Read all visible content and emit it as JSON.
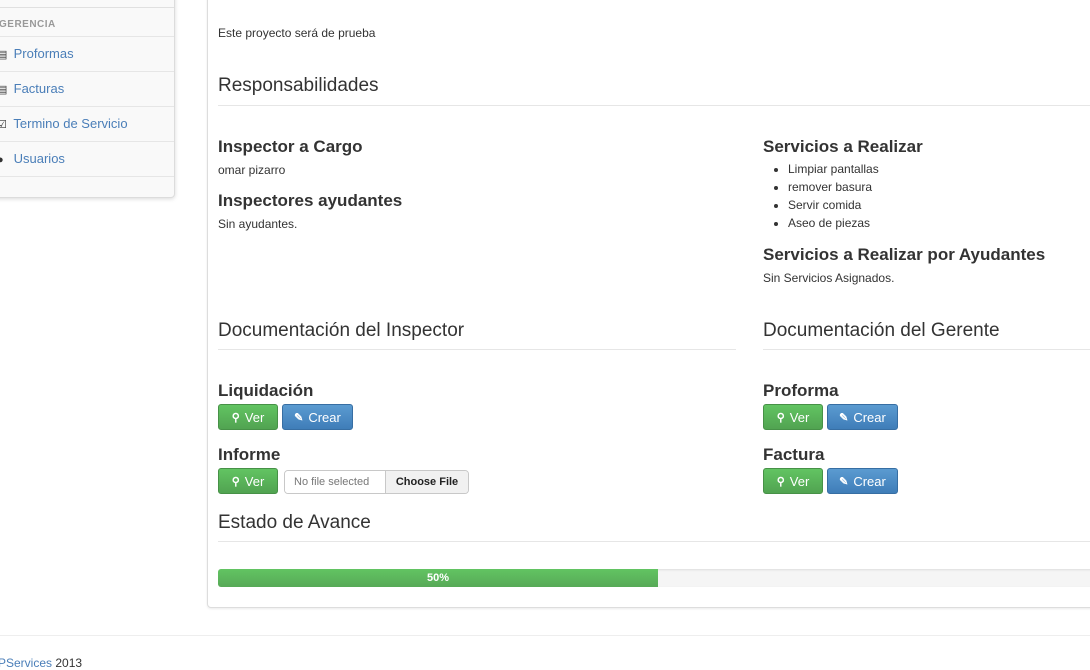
{
  "sidebar": {
    "header": "GERENCIA",
    "items": [
      {
        "icon": "list-icon",
        "label": "Proformas"
      },
      {
        "icon": "list-icon",
        "label": "Facturas"
      },
      {
        "icon": "check-icon",
        "label": "Termino de Servicio"
      },
      {
        "icon": "user-icon",
        "label": "Usuarios"
      }
    ]
  },
  "project": {
    "description": "Este proyecto será de prueba"
  },
  "responsibilities": {
    "title": "Responsabilidades",
    "inspector_heading": "Inspector a Cargo",
    "inspector_name": "omar pizarro",
    "helpers_heading": "Inspectores ayudantes",
    "helpers_value": "Sin ayudantes.",
    "services_heading": "Servicios a Realizar",
    "services": [
      "Limpiar pantallas",
      "remover basura",
      "Servir comida",
      "Aseo de piezas"
    ],
    "helper_services_heading": "Servicios a Realizar por Ayudantes",
    "helper_services_value": "Sin Servicios Asignados."
  },
  "inspector_docs": {
    "title": "Documentación del Inspector",
    "liquidacion_heading": "Liquidación",
    "informe_heading": "Informe",
    "file_status": "No file selected",
    "file_button": "Choose File"
  },
  "manager_docs": {
    "title": "Documentación del Gerente",
    "proforma_heading": "Proforma",
    "factura_heading": "Factura"
  },
  "buttons": {
    "view_label": "Ver",
    "create_label": "Crear"
  },
  "progress": {
    "title": "Estado de Avance",
    "value_percent": 50,
    "label": "50%"
  },
  "footer": {
    "brand": "PServices",
    "year": "2013"
  },
  "colors": {
    "success": "#5bb75b",
    "primary": "#4a8bc6",
    "link": "#4a7eb8"
  }
}
